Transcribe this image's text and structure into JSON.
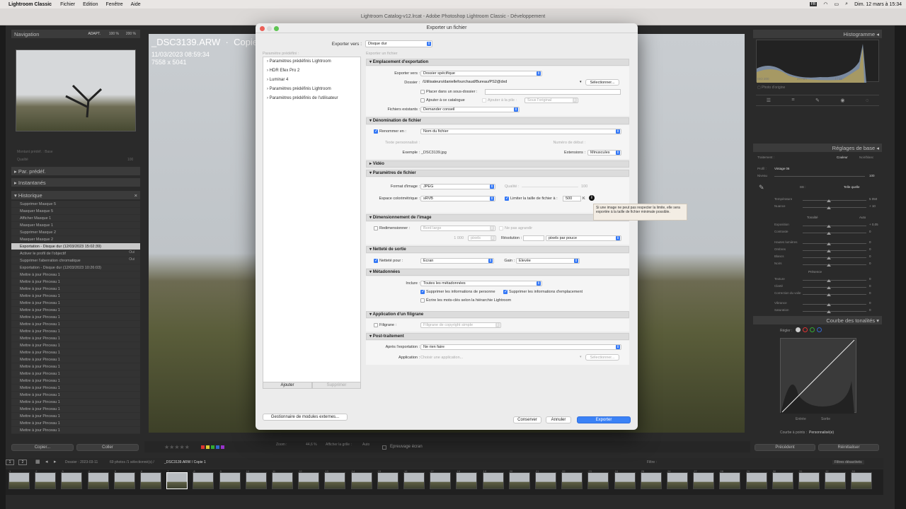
{
  "menubar": {
    "app": "Lightroom Classic",
    "items": [
      "Fichier",
      "Edition",
      "Fenêtre",
      "Aide"
    ],
    "datetime": "Dim. 12 mars à 15:34",
    "lang": "FR"
  },
  "window": {
    "title": "Lightroom Catalog-v12.lrcat - Adobe Photoshop Lightroom Classic - Développement"
  },
  "left": {
    "navigator": {
      "title": "Navigation",
      "zoom": [
        "ADAPT.",
        "100 %",
        "200 %"
      ]
    },
    "preset_amount": "Montant prédéf. : Base",
    "quality_label": "Qualité",
    "quality_value": "100",
    "panels": [
      "Par. prédéf.",
      "Instantanés",
      "Historique"
    ],
    "history": [
      "Supprimer Masque 5",
      "Masquer Masque 5",
      "Afficher Masque 1",
      "Masquer Masque 1",
      "Supprimer Masque 2",
      "Masquer Masque 2",
      "Exportation - Disque dur (12/03/2023 15:02:39)",
      "Activer le profil de l'objectif",
      "Supprimer l'aberration chromatique",
      "Exportation - Disque dur (12/03/2023 10:26:03)",
      "Mettre à jour Pinceau 1",
      "Mettre à jour Pinceau 1",
      "Mettre à jour Pinceau 1",
      "Mettre à jour Pinceau 1",
      "Mettre à jour Pinceau 1",
      "Mettre à jour Pinceau 1",
      "Mettre à jour Pinceau 1",
      "Mettre à jour Pinceau 1",
      "Mettre à jour Pinceau 1",
      "Mettre à jour Pinceau 1",
      "Mettre à jour Pinceau 1",
      "Mettre à jour Pinceau 1",
      "Mettre à jour Pinceau 1",
      "Mettre à jour Pinceau 1",
      "Mettre à jour Pinceau 1",
      "Mettre à jour Pinceau 1",
      "Mettre à jour Pinceau 1",
      "Mettre à jour Pinceau 1",
      "Mettre à jour Pinceau 1",
      "Mettre à jour Pinceau 1",
      "Mettre à jour Pinceau 1",
      "Mettre à jour Pinceau 1",
      "Mettre à jour Pinceau 1"
    ],
    "history_values": {
      "7": "Oui",
      "8": "Oui"
    },
    "copy": "Copier...",
    "paste": "Coller"
  },
  "photo": {
    "filename": "_DSC3139.ARW",
    "copy": "Copie 1",
    "date": "11/03/2023 08:59:34",
    "size": "7558 x 5041"
  },
  "right": {
    "histogram": {
      "title": "Histogramme",
      "iso": "ISO 200",
      "focal": "24 mm",
      "aperture": "f / 11",
      "photo_origin": "Photo d'origine"
    },
    "basic": {
      "title": "Réglages de base",
      "treatment": "Traitement :",
      "color": "Couleur",
      "bw": "Noir/blanc",
      "profile": "Profil :",
      "profile_value": "Vintage 06",
      "level": "Niveau",
      "level_value": "100",
      "wb": "BB :",
      "wb_value": "Telle quelle",
      "temp": "Température",
      "temp_value": "5 050",
      "tint": "Nuance",
      "tint_value": "+ 10",
      "tone": "Tonalité",
      "auto": "Auto",
      "exposure": "Exposition",
      "exposure_value": "+ 0,05",
      "contrast": "Contraste",
      "contrast_value": "0",
      "highlights": "Hautes lumières",
      "highlights_value": "0",
      "shadows": "Ombres",
      "shadows_value": "0",
      "whites": "Blancs",
      "whites_value": "0",
      "blacks": "Noirs",
      "blacks_value": "0",
      "presence": "Présence",
      "texture": "Texture",
      "texture_value": "0",
      "clarity": "Clarté",
      "clarity_value": "0",
      "dehaze": "Correction du voile",
      "dehaze_value": "0",
      "vibrance": "Vibrance",
      "vibrance_value": "0",
      "saturation": "Saturation",
      "saturation_value": "0"
    },
    "tonecurve": {
      "title": "Courbe des tonalités",
      "adjust": "Régler :",
      "input": "Entrée",
      "output": "Sortie",
      "points": "Courbe à points :",
      "points_value": "Personnalisé(e)"
    },
    "prev": "Précédent",
    "reset": "Réinitialiser"
  },
  "toolbar": {
    "zoom_label": "Zoom :",
    "zoom_value": "44,6 %",
    "grid": "Afficher la grille :",
    "grid_value": "Auto",
    "softproof": "Epreuvage écran"
  },
  "filmbar": {
    "folder": "Dossier : 2023-03-11",
    "count": "69 photos /1 sélectionné(s) /",
    "file": "_DSC3139.ARW / Copie 1",
    "filter": "Filtre :",
    "filter_value": "Filtres désactivés"
  },
  "dialog": {
    "title": "Exporter un fichier",
    "export_to_label": "Exporter vers :",
    "export_to": "Disque dur",
    "preset_label": "Paramètre prédéfini :",
    "export_file_label": "Exporter un fichier",
    "presets": [
      "Paramètres prédéfinis Lightroom",
      "HDR Efex Pro 2",
      "Luminar 4",
      "Paramètres prédéfinis Lightroom",
      "Paramètres prédéfinis de l'utilisateur"
    ],
    "add": "Ajouter",
    "remove": "Supprimer",
    "plugins": "Gestionnaire de modules externes...",
    "cancel": "Conserver",
    "annuler": "Annuler",
    "export": "Exporter",
    "loc": {
      "title": "Emplacement d'exportation",
      "export_to_label": "Exporter vers :",
      "export_to": "Dossier spécifique",
      "folder_label": "Dossier :",
      "folder": "/Utilisateurs/daniellefourchaud/Bureau/PS2@dxd",
      "choose": "Sélectionner...",
      "subfolder": "Placer dans un sous-dossier :",
      "add_catalog": "Ajouter à ce catalogue",
      "add_stack": "Ajouter à la pile :",
      "under_original": "Sous l'original",
      "existing_label": "Fichiers existants :",
      "existing": "Demander conseil"
    },
    "naming": {
      "title": "Dénomination de fichier",
      "rename": "Renommer en :",
      "rename_value": "Nom du fichier",
      "custom_text": "Texte personnalisé :",
      "start_number": "Numéro de début :",
      "example_label": "Exemple :",
      "example": "_DSC3139.jpg",
      "ext_label": "Extensions :",
      "ext": "Minuscules"
    },
    "video": {
      "title": "Vidéo"
    },
    "fileparams": {
      "title": "Paramètres de fichier",
      "format_label": "Format d'image :",
      "format": "JPEG",
      "quality_label": "Qualité :",
      "quality_value": "100",
      "colorspace_label": "Espace colorimétrique :",
      "colorspace": "sRVB",
      "limit": "Limiter la taille de fichier à :",
      "limit_value": "500",
      "unit": "K",
      "tooltip": "Si une image ne peut pas respecter la limite, elle sera exportée à la taille de fichier minimale possible."
    },
    "resize": {
      "title": "Dimensionnement de l'image",
      "resize": "Redimensionner :",
      "resize_value": "Bord large",
      "no_enlarge": "Ne pas agrandir",
      "px_value": "1 000",
      "px_unit": "pixels",
      "res_label": "Résolution :",
      "res_unit": "pixels par pouce"
    },
    "sharpen": {
      "title": "Netteté de sortie",
      "label": "Netteté pour :",
      "value": "Ecran",
      "gain_label": "Gain :",
      "gain": "Elevée"
    },
    "meta": {
      "title": "Métadonnées",
      "include_label": "Inclure :",
      "include": "Toutes les métadonnées",
      "remove_person": "Supprimer les informations de personne",
      "remove_location": "Supprimer les informations d'emplacement",
      "hierarchy": "Écrire les mots-clés selon la hiérarchie Lightroom"
    },
    "watermark": {
      "title": "Application d'un filigrane",
      "label": "Filigrane :",
      "value": "Filigrane de copyright simple"
    },
    "post": {
      "title": "Post-traitement",
      "after_label": "Après l'exportation :",
      "after": "Ne rien faire",
      "app_label": "Application :",
      "app": "Choisir une application...",
      "choose": "Sélectionner..."
    }
  },
  "filmstrip_numbers": [
    "1",
    "2",
    "3",
    "4",
    "5",
    "6",
    "7",
    "8",
    "9",
    "10",
    "11",
    "12",
    "13",
    "14",
    "15",
    "16",
    "17",
    "18",
    "19",
    "20",
    "21",
    "22",
    "23",
    "24",
    "25",
    "26",
    "27",
    "28",
    "29",
    "30",
    "31",
    "32",
    "33"
  ],
  "colors": {
    "accent": "#3478f6",
    "panel": "#2a2a2a",
    "header": "#3b3b3b"
  }
}
